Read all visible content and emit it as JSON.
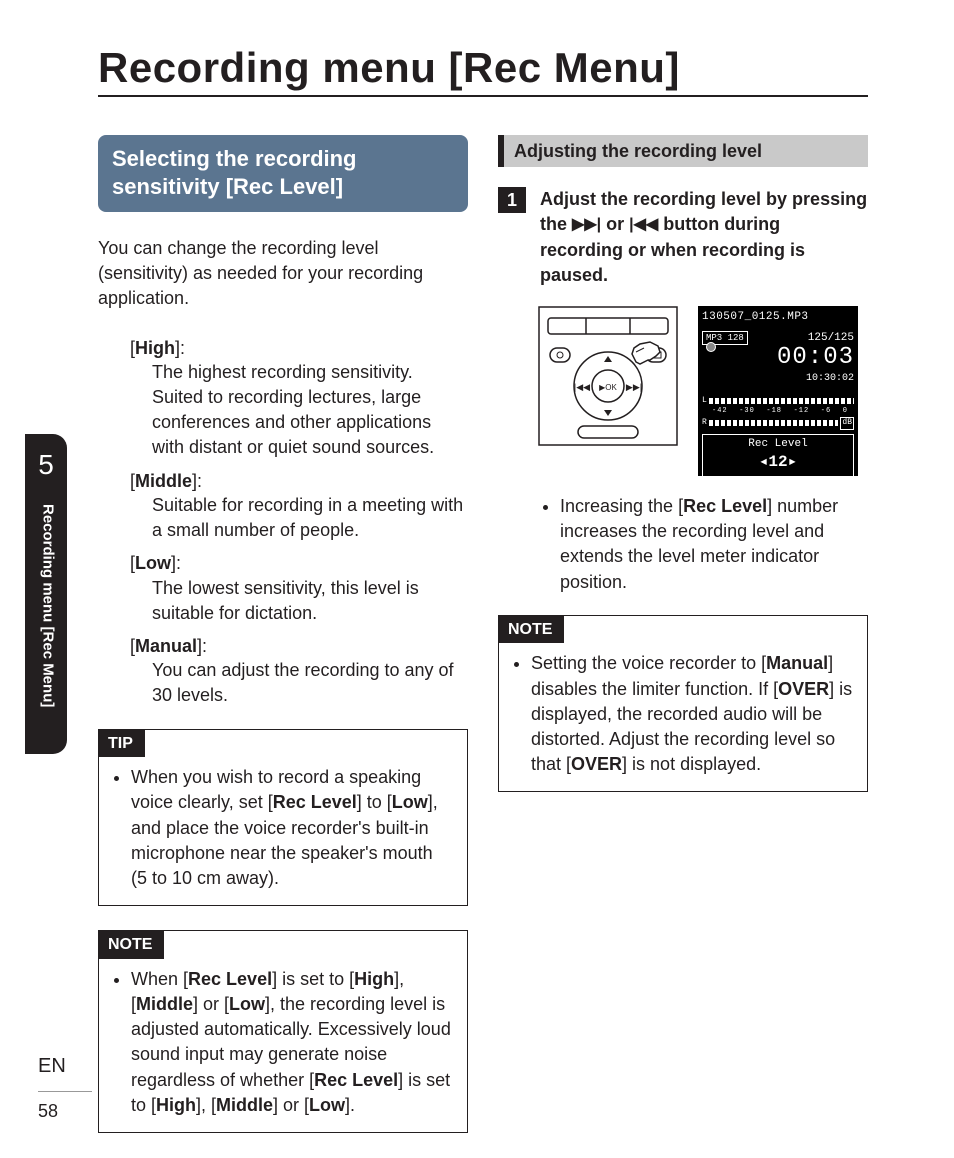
{
  "page": {
    "title": "Recording menu [Rec Menu]",
    "chapter_num": "5",
    "side_tab_text": "Recording menu [Rec Menu]",
    "language": "EN",
    "page_number": "58"
  },
  "left": {
    "heading": "Selecting the recording sensitivity [Rec Level]",
    "intro": "You can change the recording level (sensitivity) as needed for your recording application.",
    "options": [
      {
        "term": "High",
        "desc": "The highest recording sensitivity. Suited to recording lectures, large conferences and other applications with distant or quiet sound sources."
      },
      {
        "term": "Middle",
        "desc": "Suitable for recording in a meeting with a small number of people."
      },
      {
        "term": "Low",
        "desc": "The lowest sensitivity, this level is suitable for dictation."
      },
      {
        "term": "Manual",
        "desc": "You can adjust the recording to any of 30 levels."
      }
    ],
    "tip_label": "TIP",
    "tip_text_pre": "When you wish to record a speaking voice clearly, set [",
    "tip_bold1": "Rec Level",
    "tip_text_mid": "] to [",
    "tip_bold2": "Low",
    "tip_text_post": "], and place the voice recorder's built-in microphone near the speaker's mouth (5 to 10 cm away).",
    "note_label": "NOTE",
    "note_text": "When [Rec Level] is set to [High], [Middle] or [Low], the recording level is adjusted automatically. Excessively loud sound input may generate noise regardless of whether [Rec Level] is set to [High], [Middle] or [Low].",
    "note_bold": [
      "Rec Level",
      "High",
      "Middle",
      "Low",
      "Rec Level",
      "High",
      "Middle",
      "Low"
    ]
  },
  "right": {
    "heading": "Adjusting the recording level",
    "step_num": "1",
    "step_pre": "Adjust the recording level by pressing the ",
    "step_mid": " or ",
    "step_post": " button during recording or when recording is paused.",
    "lcd": {
      "file": "130507_0125.MP3",
      "counter": "125/125",
      "format": "MP3 128",
      "time_big": "00:03",
      "time_small": "10:30:02",
      "scale": [
        "-42",
        "-30",
        "-18",
        "-12",
        "-6",
        "0",
        "dB"
      ],
      "rec_level_label": "Rec Level",
      "rec_level_value": "12"
    },
    "bullet_pre": "Increasing the [",
    "bullet_bold": "Rec Level",
    "bullet_post": "] number increases the recording level and extends the level meter indicator position.",
    "note_label": "NOTE",
    "note_pre": "Setting the voice recorder to [",
    "note_b1": "Manual",
    "note_mid1": "] disables the limiter function. If [",
    "note_b2": "OVER",
    "note_mid2": "] is displayed, the recorded audio will be distorted. Adjust the recording level so that [",
    "note_b3": "OVER",
    "note_post": "] is not displayed."
  }
}
